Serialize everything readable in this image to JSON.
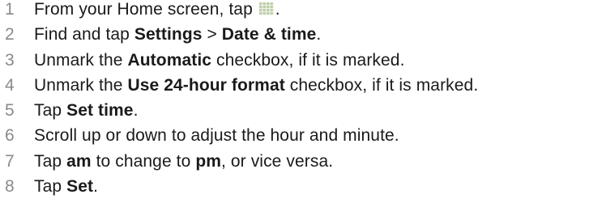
{
  "steps": [
    {
      "num": "1",
      "parts": [
        "From your Home screen, tap ",
        "."
      ],
      "icon": "app-grid-icon"
    },
    {
      "num": "2",
      "parts": [
        "Find and tap ",
        "Settings",
        " > ",
        "Date & time",
        "."
      ]
    },
    {
      "num": "3",
      "parts": [
        "Unmark the ",
        "Automatic",
        " checkbox, if it is marked."
      ]
    },
    {
      "num": "4",
      "parts": [
        "Unmark the ",
        "Use 24-hour format",
        " checkbox, if it is marked."
      ]
    },
    {
      "num": "5",
      "parts": [
        "Tap ",
        "Set time",
        "."
      ]
    },
    {
      "num": "6",
      "parts": [
        "Scroll up or down to adjust the hour and minute."
      ]
    },
    {
      "num": "7",
      "parts": [
        "Tap ",
        "am",
        " to change to ",
        "pm",
        ", or vice versa."
      ]
    },
    {
      "num": "8",
      "parts": [
        "Tap ",
        "Set",
        "."
      ]
    }
  ],
  "colors": {
    "number": "#8a8a8a",
    "text": "#1a1a1a",
    "icon": "#b8c8a0"
  }
}
